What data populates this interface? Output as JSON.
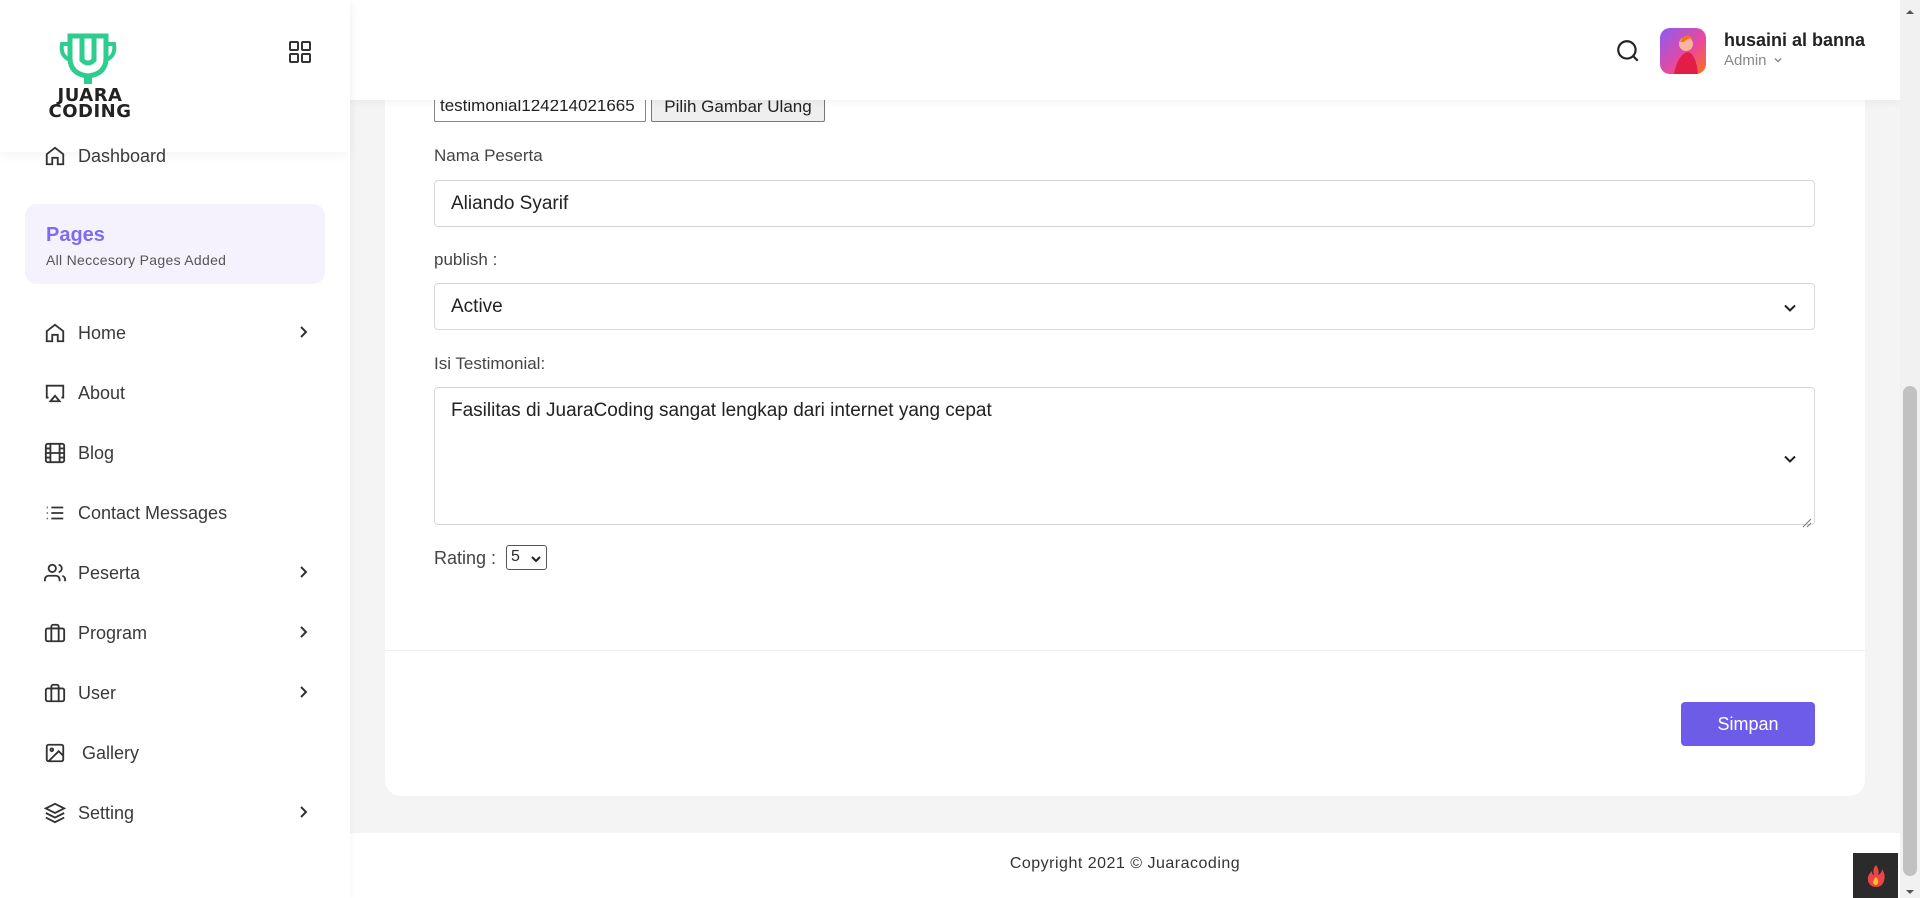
{
  "sidebar": {
    "logo_text_line1": "JUARA",
    "logo_text_line2": "CODING",
    "dashboard": "Dashboard",
    "pages_title": "Pages",
    "pages_subtitle": "All Neccesory Pages Added",
    "items": [
      {
        "label": "Home",
        "icon": "home-icon",
        "has_submenu": true
      },
      {
        "label": "About",
        "icon": "airplay-icon",
        "has_submenu": false
      },
      {
        "label": "Blog",
        "icon": "film-icon",
        "has_submenu": false
      },
      {
        "label": "Contact Messages",
        "icon": "list-icon",
        "has_submenu": false
      },
      {
        "label": "Peserta",
        "icon": "users-icon",
        "has_submenu": true
      },
      {
        "label": "Program",
        "icon": "briefcase-icon",
        "has_submenu": true
      },
      {
        "label": "User",
        "icon": "briefcase-icon",
        "has_submenu": true
      },
      {
        "label": "Gallery",
        "icon": "image-icon",
        "has_submenu": false
      },
      {
        "label": "Setting",
        "icon": "layers-icon",
        "has_submenu": true
      }
    ]
  },
  "header": {
    "user_name": "husaini al banna",
    "user_role": "Admin"
  },
  "form": {
    "file_name": "testimonial124214021665",
    "file_button": "Pilih Gambar Ulang",
    "nama_label": "Nama Peserta",
    "nama_value": "Aliando Syarif",
    "publish_label": "publish :",
    "publish_value": "Active",
    "isi_label": "Isi Testimonial:",
    "isi_value": "Fasilitas di JuaraCoding sangat lengkap dari internet yang cepat",
    "rating_label": "Rating :",
    "rating_value": "5",
    "save_label": "Simpan"
  },
  "footer": {
    "copyright": "Copyright 2021 © Juaracoding"
  },
  "colors": {
    "accent": "#6c5ce7",
    "pages_title": "#7d6cf0",
    "logo_green": "#2ecc8e"
  }
}
